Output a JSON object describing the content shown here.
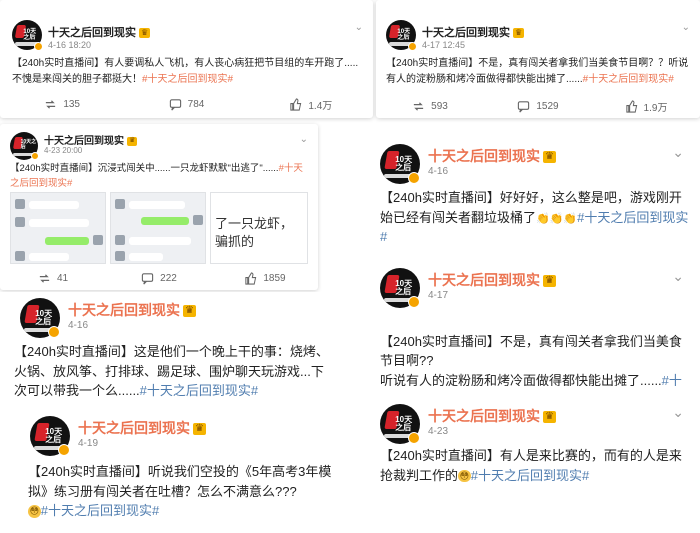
{
  "account": {
    "name": "十天之后回到现实",
    "avatar_text": "10天之后",
    "vip_label": "♛",
    "brand_color": "#eb7350"
  },
  "posts": [
    {
      "date": "4-16 18:20",
      "text": "【240h实时直播间】有人要调私人飞机，有人丧心病狂把节目组的车开跑了.....不愧是来闯关的胆子都挺大！",
      "tag": "#十天之后回到现实#",
      "repost": "135",
      "comment": "784",
      "like": "1.4万"
    },
    {
      "date": "4-17 12:45",
      "text": "【240h实时直播间】不是，真有闯关者拿我们当美食节目啊？？听说有人的淀粉肠和烤冷面做得都快能出摊了......",
      "tag": "#十天之后回到现实#",
      "repost": "593",
      "comment": "1529",
      "like": "1.9万"
    },
    {
      "date": "4-23 20:00",
      "text": "【240h实时直播间】沉浸式闯关中......一只龙虾默默\"出逃了\"......",
      "tag": "#十天之后回到现实#",
      "image_caption": "了一只龙虾，骗抓的",
      "repost": "41",
      "comment": "222",
      "like": "1859"
    },
    {
      "date": "4-16",
      "text": "【240h实时直播间】好好好，这么整是吧，游戏刚开始已经有闯关者翻垃圾桶了",
      "emoji": "👏👏👏",
      "tag": "#十天之后回到现实#"
    },
    {
      "date": "4-16",
      "text": "【240h实时直播间】这是他们一个晚上干的事：烧烤、火锅、放风筝、打排球、踢足球、围炉聊天玩游戏...下次可以带我一个么......",
      "tag": "#十天之后回到现实#"
    },
    {
      "date": "4-17",
      "text": "【240h实时直播间】不是，真有闯关者拿我们当美食节目啊??\n听说有人的淀粉肠和烤冷面做得都快能出摊了......",
      "tag": "#十天之后回到现实#"
    },
    {
      "date": "4-19",
      "text": "【240h实时直播间】听说我们空投的《5年高考3年模拟》练习册有闯关者在吐槽？怎么不满意么???",
      "emoji": "😳",
      "tag": "#十天之后回到现实#"
    },
    {
      "date": "4-23",
      "text": "【240h实时直播间】有人是来比赛的，而有的人是来抢裁判工作的",
      "emoji": "😳",
      "tag": "#十天之后回到现实#"
    }
  ]
}
